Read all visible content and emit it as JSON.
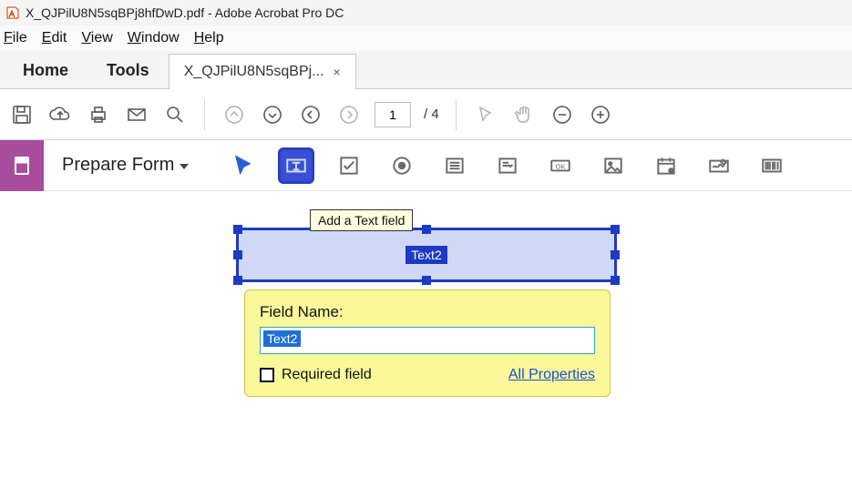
{
  "titlebar": {
    "filename": "X_QJPilU8N5sqBPj8hfDwD.pdf",
    "separator": " - ",
    "app_name": "Adobe Acrobat Pro DC"
  },
  "menubar": {
    "file": "File",
    "edit": "Edit",
    "view": "View",
    "window": "Window",
    "help": "Help"
  },
  "tabrow": {
    "home": "Home",
    "tools": "Tools",
    "doc_tab": "X_QJPilU8N5sqBPj...",
    "close": "×"
  },
  "toolbar": {
    "page_current": "1",
    "page_sep": "/",
    "page_total": "4"
  },
  "formbar": {
    "label": "Prepare Form",
    "tooltip": "Add a Text field"
  },
  "field": {
    "display_name": "Text2"
  },
  "popover": {
    "field_name_label": "Field Name:",
    "field_name_value": "Text2",
    "required_label": "Required field",
    "all_properties": "All Properties"
  }
}
